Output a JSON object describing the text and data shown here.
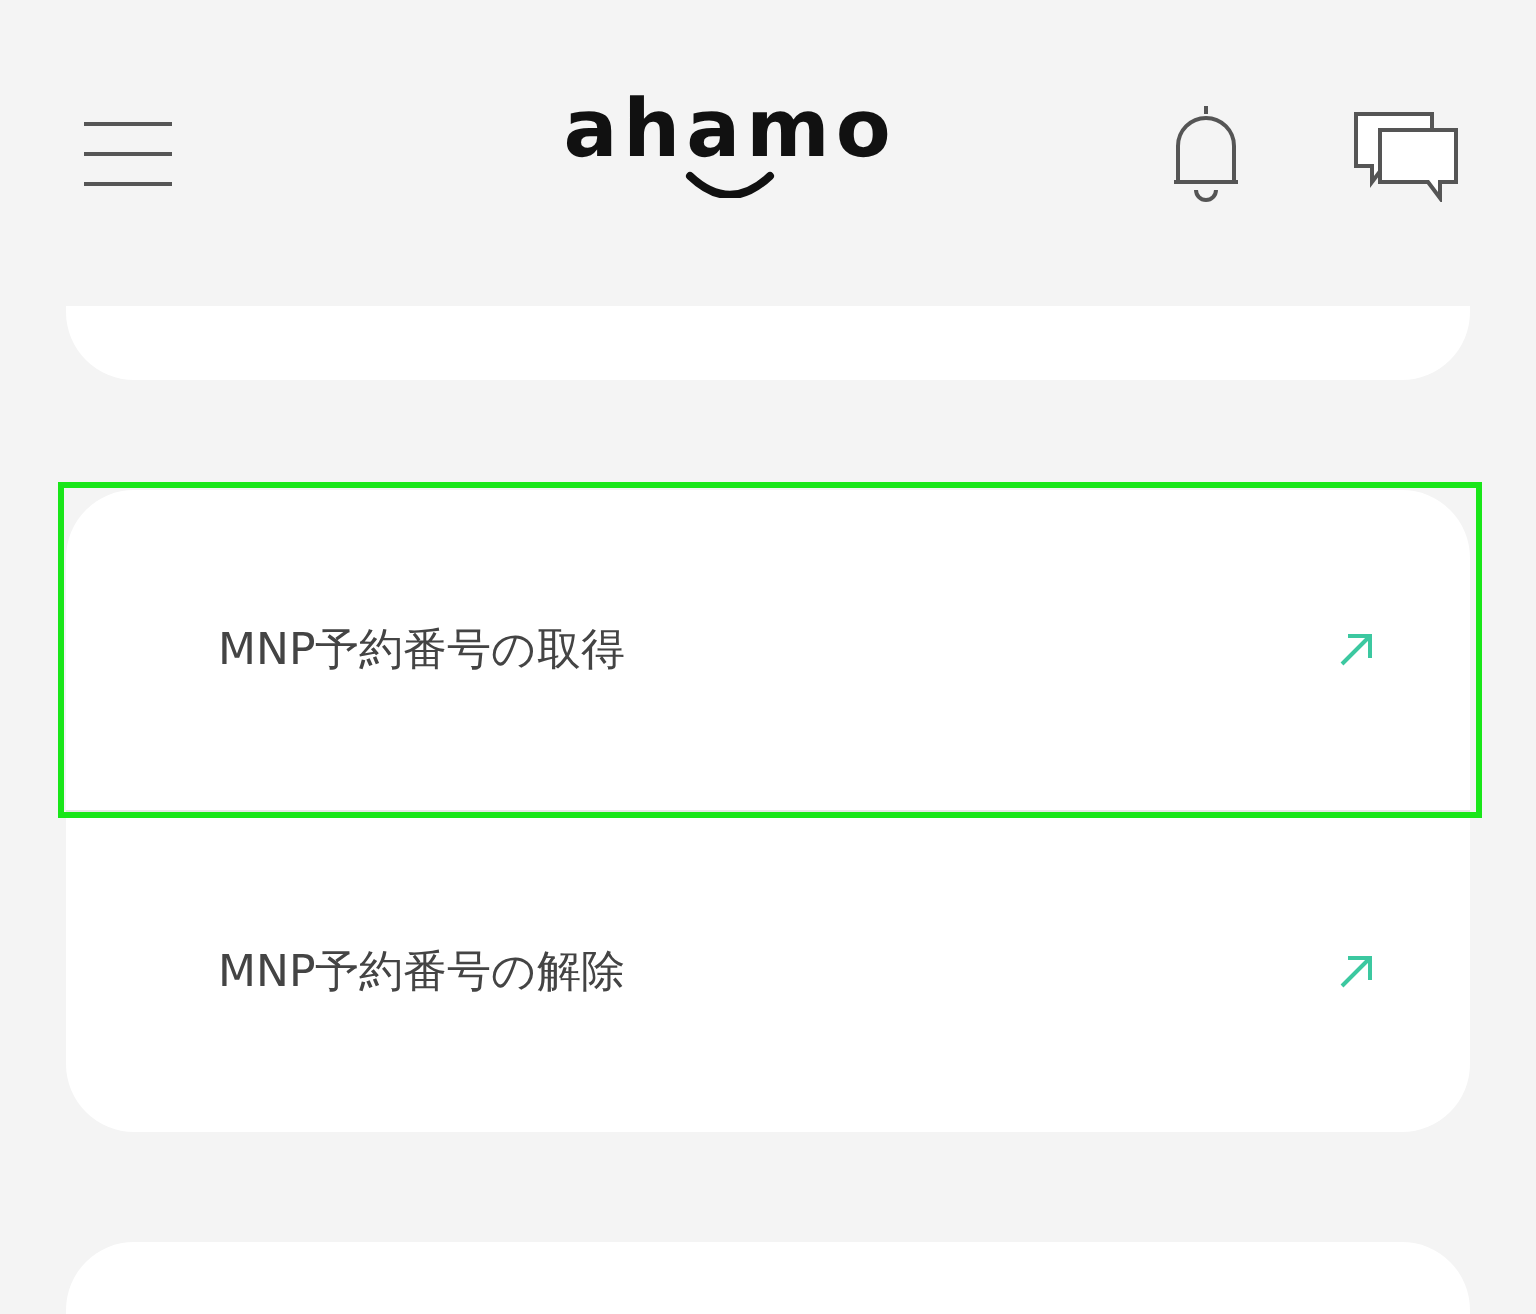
{
  "header": {
    "logo": "ahamo"
  },
  "menu_items": [
    {
      "label": "MNP予約番号の取得",
      "highlighted": true
    },
    {
      "label": "MNP予約番号の解除",
      "highlighted": false
    }
  ]
}
